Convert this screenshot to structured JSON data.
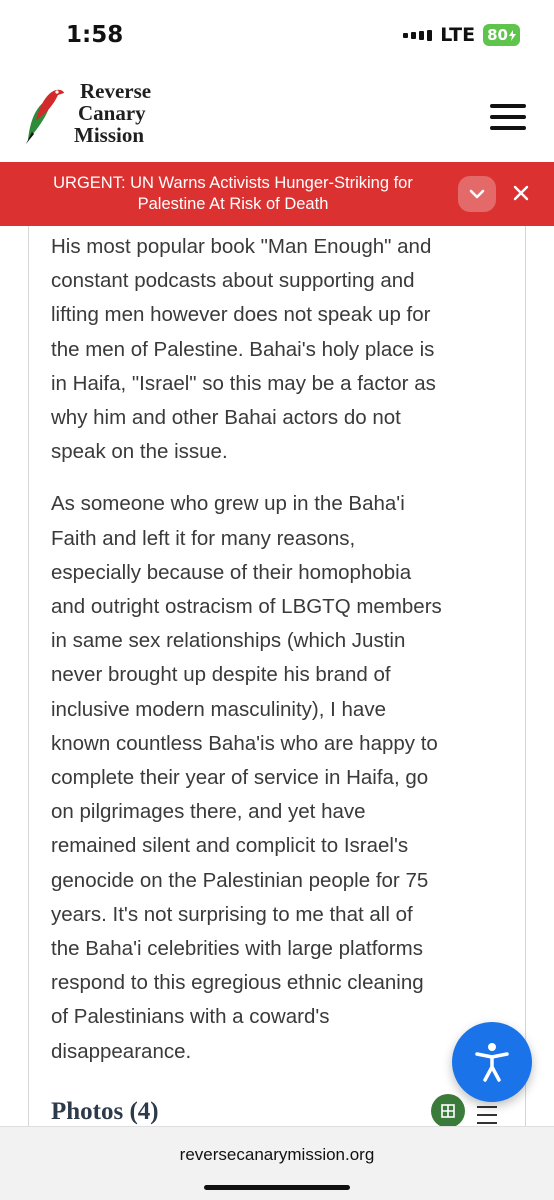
{
  "status_bar": {
    "time": "1:58",
    "network": "LTE",
    "battery": "80"
  },
  "header": {
    "logo_line1": "Reverse",
    "logo_line2": "Canary",
    "logo_line3": "Mission",
    "menu_icon": "hamburger-menu-icon"
  },
  "urgent_banner": {
    "line1": "URGENT: UN Warns Activists Hunger-Striking for",
    "line2": "Palestine At Risk of Death",
    "expand_icon": "chevron-down-icon",
    "close_icon": "close-icon",
    "color": "#dc3131"
  },
  "article": {
    "paragraph1": [
      "His most popular book \"Man Enough\" and",
      "constant podcasts about supporting and",
      "lifting men however does not speak up for",
      "the men of Palestine. Bahai's holy place is",
      "in Haifa, \"Israel\" so this may be a factor as",
      "why him and other Bahai actors do not",
      "speak on the issue."
    ],
    "paragraph2": [
      "As someone who grew up in the Baha'i",
      "Faith and left it for many reasons,",
      "especially because of their homophobia",
      "and outright ostracism of LBGTQ members",
      "in same sex relationships (which Justin",
      "never brought up despite his brand of",
      "inclusive modern masculinity), I have",
      "known countless Baha'is who are happy to",
      "complete their year of service in Haifa, go",
      "on pilgrimages there, and yet have",
      "remained silent and complicit to Israel's",
      "genocide on the Palestinian people for 75",
      "years. It's not surprising to me that all of",
      "the Baha'i celebrities with large platforms",
      "respond to this egregious ethnic cleaning",
      "of Palestinians with a coward's",
      "disappearance."
    ]
  },
  "photos": {
    "heading": "Photos (4)",
    "grid_icon": "grid-view-icon",
    "list_icon": "list-view-icon"
  },
  "accessibility": {
    "icon": "accessibility-icon",
    "color": "#1a73e8"
  },
  "browser": {
    "url": "reversecanarymission.org"
  }
}
